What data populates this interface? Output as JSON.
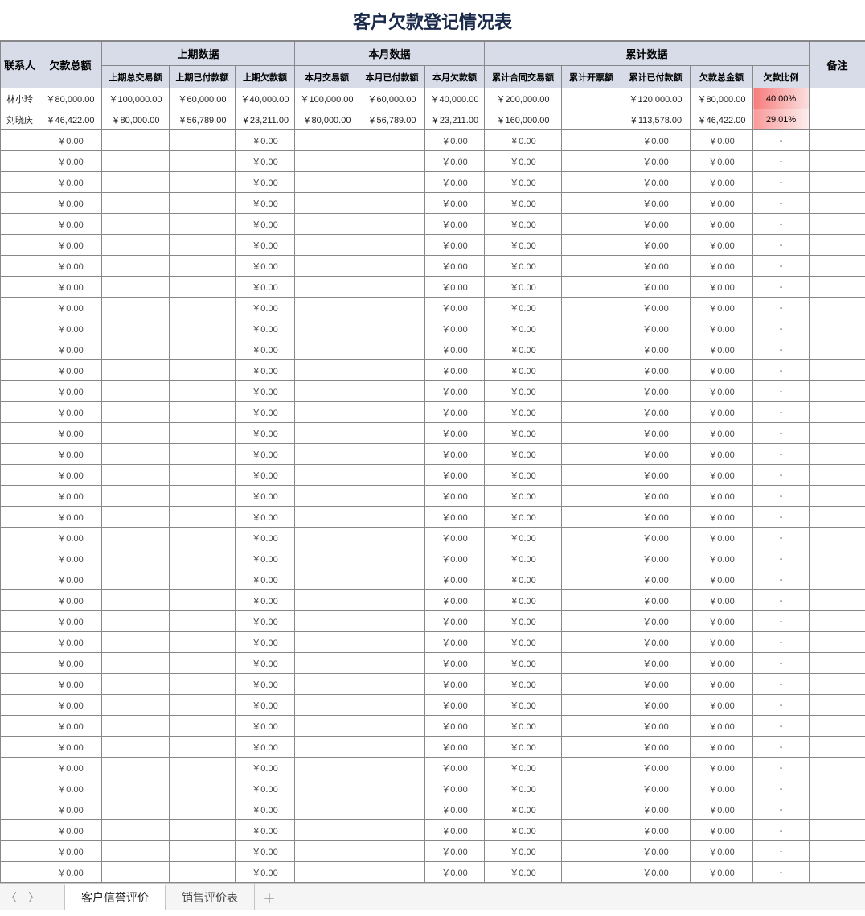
{
  "title": "客户欠款登记情况表",
  "headers": {
    "contact": "联系人",
    "total_debt": "欠款总额",
    "prev_group": "上期数据",
    "month_group": "本月数据",
    "accum_group": "累计数据",
    "remark": "备注",
    "prev_trans": "上期总交易额",
    "prev_paid": "上期已付款额",
    "prev_debt": "上期欠款额",
    "month_trans": "本月交易额",
    "month_paid": "本月已付款额",
    "month_debt": "本月欠款额",
    "accum_contract": "累计合同交易额",
    "accum_invoice": "累计开票额",
    "accum_paid": "累计已付款额",
    "accum_debt": "欠款总金额",
    "debt_ratio": "欠款比例"
  },
  "rows": [
    {
      "contact": "林小玲",
      "total_debt": "￥80,000.00",
      "prev_trans": "￥100,000.00",
      "prev_paid": "￥60,000.00",
      "prev_debt": "￥40,000.00",
      "month_trans": "￥100,000.00",
      "month_paid": "￥60,000.00",
      "month_debt": "￥40,000.00",
      "accum_contract": "￥200,000.00",
      "accum_invoice": "",
      "accum_paid": "￥120,000.00",
      "accum_debt": "￥80,000.00",
      "debt_ratio": "40.00%",
      "ratio_class": "ratio-warn",
      "remark": ""
    },
    {
      "contact": "刘晓庆",
      "total_debt": "￥46,422.00",
      "prev_trans": "￥80,000.00",
      "prev_paid": "￥56,789.00",
      "prev_debt": "￥23,211.00",
      "month_trans": "￥80,000.00",
      "month_paid": "￥56,789.00",
      "month_debt": "￥23,211.00",
      "accum_contract": "￥160,000.00",
      "accum_invoice": "",
      "accum_paid": "￥113,578.00",
      "accum_debt": "￥46,422.00",
      "debt_ratio": "29.01%",
      "ratio_class": "ratio-warn2",
      "remark": ""
    }
  ],
  "empty_row": {
    "contact": "",
    "total_debt": "￥0.00",
    "prev_trans": "",
    "prev_paid": "",
    "prev_debt": "￥0.00",
    "month_trans": "",
    "month_paid": "",
    "month_debt": "￥0.00",
    "accum_contract": "￥0.00",
    "accum_invoice": "",
    "accum_paid": "￥0.00",
    "accum_debt": "￥0.00",
    "debt_ratio": "-",
    "remark": ""
  },
  "empty_row_count": 36,
  "sheets": {
    "active": "客户信誉评价",
    "others": [
      "销售评价表"
    ]
  },
  "icons": {
    "prev": "〈",
    "next": "〉",
    "add": "＋"
  }
}
